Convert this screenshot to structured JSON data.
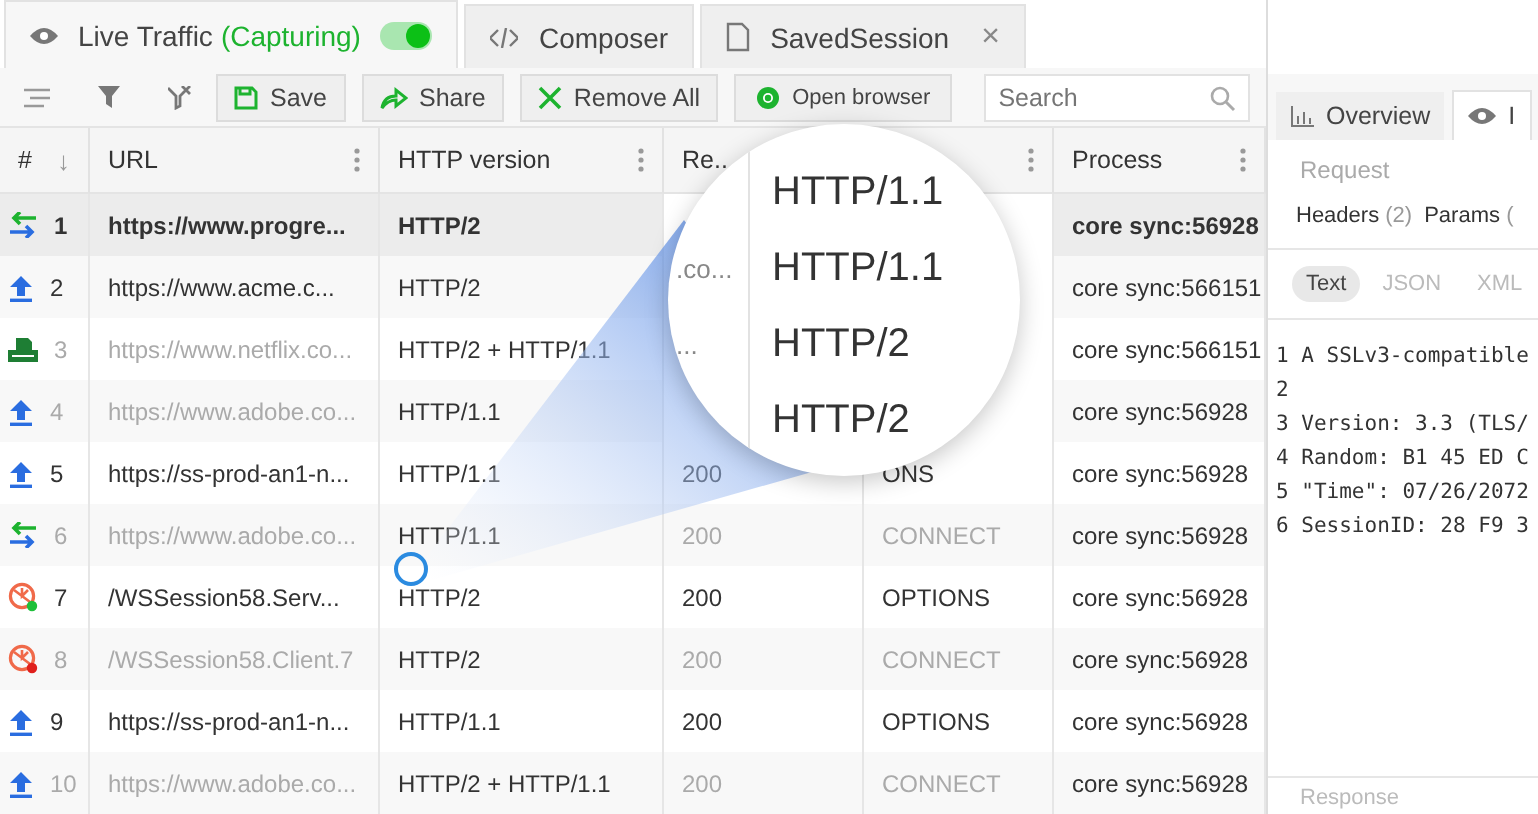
{
  "tabs": [
    {
      "kind": "live",
      "label": "Live Traffic",
      "status": "(Capturing)",
      "capturing": true,
      "selected": true
    },
    {
      "kind": "composer",
      "label": "Composer",
      "selected": false
    },
    {
      "kind": "session",
      "label": "SavedSession",
      "close": "×",
      "selected": false
    }
  ],
  "toolbar": {
    "buttons": [
      {
        "kind": "save",
        "label": "Save"
      },
      {
        "kind": "share",
        "label": "Share"
      },
      {
        "kind": "remove",
        "label": "Remove All"
      },
      {
        "kind": "browser",
        "label": "Open browser"
      }
    ],
    "search": {
      "placeholder": "Search"
    }
  },
  "table": {
    "columns": [
      {
        "label": "#",
        "sort": "↓"
      },
      {
        "label": "URL",
        "menu": true
      },
      {
        "label": "HTTP version",
        "menu": true
      },
      {
        "label": "Re.."
      },
      {
        "menu": true
      },
      {
        "label": "Process",
        "menu": true
      }
    ],
    "rows": [
      {
        "kind": "tunnel",
        "num": "1",
        "url": "https://www.progre...",
        "http": "HTTP/2",
        "process": "core sync:56928",
        "selected": true,
        "dim": false
      },
      {
        "kind": "upload",
        "num": "2",
        "url": "https://www.acme.c...",
        "http": "HTTP/2",
        "process": "core sync:566151",
        "selected": false,
        "dim": false
      },
      {
        "kind": "json",
        "num": "3",
        "url": "https://www.netflix.co...",
        "http": "HTTP/2 + HTTP/1.1",
        "process": "core sync:566151",
        "selected": false,
        "dim": true
      },
      {
        "kind": "upload",
        "num": "4",
        "url": "https://www.adobe.co...",
        "http": "HTTP/1.1",
        "process": "core sync:56928",
        "selected": false,
        "dim": true
      },
      {
        "kind": "upload",
        "num": "5",
        "url": "https://ss-prod-an1-n...",
        "http": "HTTP/1.1",
        "result": "200",
        "method": "ONS",
        "process": "core sync:56928",
        "selected": false,
        "dim": false
      },
      {
        "kind": "tunnel",
        "num": "6",
        "url": "https://www.adobe.co...",
        "http": "HTTP/1.1",
        "result": "200",
        "method": "CONNECT",
        "process": "core sync:56928",
        "selected": false,
        "dim": true
      },
      {
        "kind": "websocket",
        "color": "#1fbf3a",
        "num": "7",
        "url": "/WSSession58.Serv...",
        "http": "HTTP/2",
        "result": "200",
        "method": "OPTIONS",
        "process": "core sync:56928",
        "selected": false,
        "dim": false
      },
      {
        "kind": "websocket",
        "color": "#e0201c",
        "num": "8",
        "url": "/WSSession58.Client.7",
        "http": "HTTP/2",
        "result": "200",
        "method": "CONNECT",
        "process": "core sync:56928",
        "selected": false,
        "dim": true
      },
      {
        "kind": "upload",
        "num": "9",
        "url": "https://ss-prod-an1-n...",
        "http": "HTTP/1.1",
        "result": "200",
        "method": "OPTIONS",
        "process": "core sync:56928",
        "selected": false,
        "dim": false
      },
      {
        "kind": "upload",
        "num": "10",
        "url": "https://www.adobe.co...",
        "http": "HTTP/2 + HTTP/1.1",
        "result": "200",
        "method": "CONNECT",
        "process": "core sync:56928",
        "selected": false,
        "dim": true
      }
    ]
  },
  "magnifier": {
    "rows": [
      {
        "http": "HTTP/1.1"
      },
      {
        "url": ".co...",
        "http": "HTTP/1.1"
      },
      {
        "url": "...",
        "http": "HTTP/2"
      },
      {
        "http": "HTTP/2"
      }
    ]
  },
  "inspector": {
    "tabs": [
      {
        "kind": "overview",
        "label": "Overview",
        "selected": false
      },
      {
        "kind": "inspectors",
        "label": "I",
        "selected": true
      }
    ],
    "section": "Request",
    "subtabs": [
      {
        "label": "Headers",
        "count": "(2)"
      },
      {
        "label": "Params",
        "count": "("
      }
    ],
    "formats": [
      {
        "label": "Text",
        "selected": true
      },
      {
        "label": "JSON",
        "selected": false
      },
      {
        "label": "XML",
        "selected": false
      }
    ],
    "lines": [
      {
        "n": "1",
        "text": "A SSLv3-compatible"
      },
      {
        "n": "2"
      },
      {
        "n": "3",
        "text": "Version: 3.3 (TLS/"
      },
      {
        "n": "4",
        "text": "Random: B1 45 ED C"
      },
      {
        "n": "5",
        "text": "\"Time\": 07/26/2072"
      },
      {
        "n": "6",
        "text": "SessionID: 28 F9 3"
      }
    ],
    "footer": "Response"
  }
}
